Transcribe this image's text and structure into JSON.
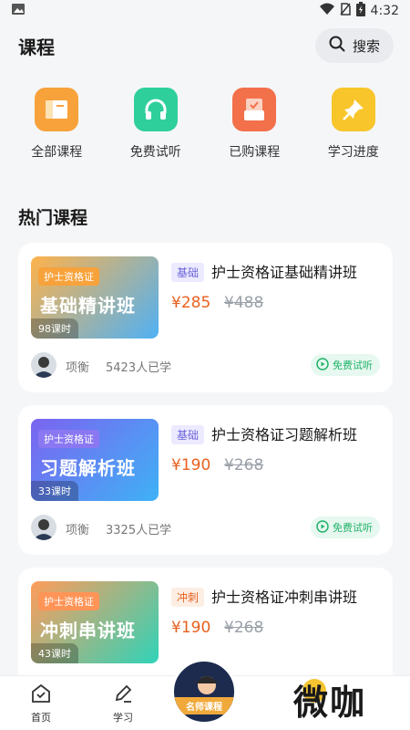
{
  "status": {
    "time": "4:32"
  },
  "header": {
    "title": "课程",
    "search_label": "搜索"
  },
  "quick_actions": [
    {
      "label": "全部课程",
      "icon": "book-icon",
      "color": "#f7a23b"
    },
    {
      "label": "免费试听",
      "icon": "headphones-icon",
      "color": "#2fcf9c"
    },
    {
      "label": "已购课程",
      "icon": "purchased-box-icon",
      "color": "#f2704a"
    },
    {
      "label": "学习进度",
      "icon": "pushpin-icon",
      "color": "#f8c52b"
    }
  ],
  "section": {
    "title": "热门课程"
  },
  "courses": [
    {
      "cover_tag": "护士资格证",
      "cover_title": "基础精讲班",
      "lessons": "98课时",
      "level": "基础",
      "name": "护士资格证基础精讲班",
      "price": "¥285",
      "old_price": "¥488",
      "teacher": "项衡",
      "learners": "5423人已学",
      "trial": "免费试听",
      "cover_colors": [
        "#ffb24a",
        "#4fb1f5"
      ],
      "badge_bg": "#eceaff",
      "badge_color": "#6b63d9"
    },
    {
      "cover_tag": "护士资格证",
      "cover_title": "习题解析班",
      "lessons": "33课时",
      "level": "基础",
      "name": "护士资格证习题解析班",
      "price": "¥190",
      "old_price": "¥268",
      "teacher": "项衡",
      "learners": "3325人已学",
      "trial": "免费试听",
      "cover_colors": [
        "#7b63f0",
        "#3fb2f6"
      ],
      "badge_bg": "#eceaff",
      "badge_color": "#6b63d9"
    },
    {
      "cover_tag": "护士资格证",
      "cover_title": "冲刺串讲班",
      "lessons": "43课时",
      "level": "冲刺",
      "name": "护士资格证冲刺串讲班",
      "price": "¥190",
      "old_price": "¥268",
      "teacher": "",
      "learners": "",
      "trial": "",
      "cover_colors": [
        "#ff9c5a",
        "#2fd3b8"
      ],
      "badge_bg": "#fdeee4",
      "badge_color": "#e8611f"
    }
  ],
  "tabs": [
    {
      "label": "首页",
      "icon": "home-icon"
    },
    {
      "label": "学习",
      "icon": "pencil-icon"
    }
  ],
  "center_badge": {
    "label": "名师课程"
  },
  "watermark": "微咖"
}
